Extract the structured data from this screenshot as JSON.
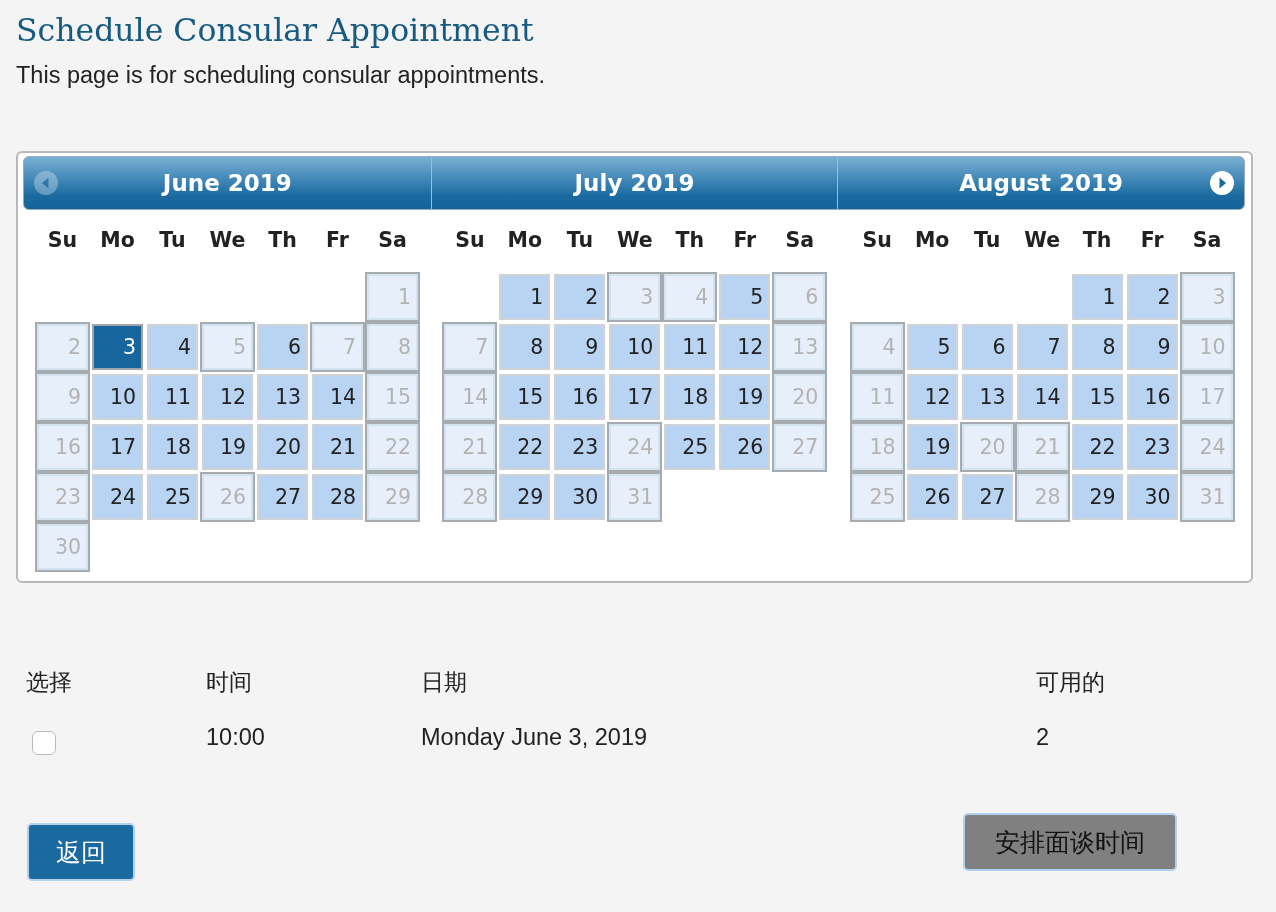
{
  "page": {
    "title": "Schedule Consular Appointment",
    "description": "This page is for scheduling consular appointments."
  },
  "calendar": {
    "previous_enabled": false,
    "next_enabled": true,
    "months": [
      {
        "title": "June 2019",
        "weekdays": [
          "Su",
          "Mo",
          "Tu",
          "We",
          "Th",
          "Fr",
          "Sa"
        ],
        "weeks": [
          [
            {
              "day": "1",
              "available": false,
              "selected": false
            }
          ],
          [
            {
              "day": "2",
              "available": false,
              "selected": false
            },
            {
              "day": "3",
              "available": true,
              "selected": true
            },
            {
              "day": "4",
              "available": true,
              "selected": false
            },
            {
              "day": "5",
              "available": false,
              "selected": false
            },
            {
              "day": "6",
              "available": true,
              "selected": false
            },
            {
              "day": "7",
              "available": false,
              "selected": false
            },
            {
              "day": "8",
              "available": false,
              "selected": false
            }
          ],
          [
            {
              "day": "9",
              "available": false,
              "selected": false
            },
            {
              "day": "10",
              "available": true,
              "selected": false
            },
            {
              "day": "11",
              "available": true,
              "selected": false
            },
            {
              "day": "12",
              "available": true,
              "selected": false
            },
            {
              "day": "13",
              "available": true,
              "selected": false
            },
            {
              "day": "14",
              "available": true,
              "selected": false
            },
            {
              "day": "15",
              "available": false,
              "selected": false
            }
          ],
          [
            {
              "day": "16",
              "available": false,
              "selected": false
            },
            {
              "day": "17",
              "available": true,
              "selected": false
            },
            {
              "day": "18",
              "available": true,
              "selected": false
            },
            {
              "day": "19",
              "available": true,
              "selected": false
            },
            {
              "day": "20",
              "available": true,
              "selected": false
            },
            {
              "day": "21",
              "available": true,
              "selected": false
            },
            {
              "day": "22",
              "available": false,
              "selected": false
            }
          ],
          [
            {
              "day": "23",
              "available": false,
              "selected": false
            },
            {
              "day": "24",
              "available": true,
              "selected": false
            },
            {
              "day": "25",
              "available": true,
              "selected": false
            },
            {
              "day": "26",
              "available": false,
              "selected": false
            },
            {
              "day": "27",
              "available": true,
              "selected": false
            },
            {
              "day": "28",
              "available": true,
              "selected": false
            },
            {
              "day": "29",
              "available": false,
              "selected": false
            }
          ],
          [
            {
              "day": "30",
              "available": false,
              "selected": false
            }
          ]
        ]
      },
      {
        "title": "July 2019",
        "weekdays": [
          "Su",
          "Mo",
          "Tu",
          "We",
          "Th",
          "Fr",
          "Sa"
        ],
        "weeks": [
          [
            {
              "day": "1",
              "available": true,
              "selected": false
            },
            {
              "day": "2",
              "available": true,
              "selected": false
            },
            {
              "day": "3",
              "available": false,
              "selected": false
            },
            {
              "day": "4",
              "available": false,
              "selected": false
            },
            {
              "day": "5",
              "available": true,
              "selected": false
            },
            {
              "day": "6",
              "available": false,
              "selected": false
            }
          ],
          [
            {
              "day": "7",
              "available": false,
              "selected": false
            },
            {
              "day": "8",
              "available": true,
              "selected": false
            },
            {
              "day": "9",
              "available": true,
              "selected": false
            },
            {
              "day": "10",
              "available": true,
              "selected": false
            },
            {
              "day": "11",
              "available": true,
              "selected": false
            },
            {
              "day": "12",
              "available": true,
              "selected": false
            },
            {
              "day": "13",
              "available": false,
              "selected": false
            }
          ],
          [
            {
              "day": "14",
              "available": false,
              "selected": false
            },
            {
              "day": "15",
              "available": true,
              "selected": false
            },
            {
              "day": "16",
              "available": true,
              "selected": false
            },
            {
              "day": "17",
              "available": true,
              "selected": false
            },
            {
              "day": "18",
              "available": true,
              "selected": false
            },
            {
              "day": "19",
              "available": true,
              "selected": false
            },
            {
              "day": "20",
              "available": false,
              "selected": false
            }
          ],
          [
            {
              "day": "21",
              "available": false,
              "selected": false
            },
            {
              "day": "22",
              "available": true,
              "selected": false
            },
            {
              "day": "23",
              "available": true,
              "selected": false
            },
            {
              "day": "24",
              "available": false,
              "selected": false
            },
            {
              "day": "25",
              "available": true,
              "selected": false
            },
            {
              "day": "26",
              "available": true,
              "selected": false
            },
            {
              "day": "27",
              "available": false,
              "selected": false
            }
          ],
          [
            {
              "day": "28",
              "available": false,
              "selected": false
            },
            {
              "day": "29",
              "available": true,
              "selected": false
            },
            {
              "day": "30",
              "available": true,
              "selected": false
            },
            {
              "day": "31",
              "available": false,
              "selected": false
            }
          ]
        ]
      },
      {
        "title": "August 2019",
        "weekdays": [
          "Su",
          "Mo",
          "Tu",
          "We",
          "Th",
          "Fr",
          "Sa"
        ],
        "weeks": [
          [
            {
              "day": "1",
              "available": true,
              "selected": false
            },
            {
              "day": "2",
              "available": true,
              "selected": false
            },
            {
              "day": "3",
              "available": false,
              "selected": false
            }
          ],
          [
            {
              "day": "4",
              "available": false,
              "selected": false
            },
            {
              "day": "5",
              "available": true,
              "selected": false
            },
            {
              "day": "6",
              "available": true,
              "selected": false
            },
            {
              "day": "7",
              "available": true,
              "selected": false
            },
            {
              "day": "8",
              "available": true,
              "selected": false
            },
            {
              "day": "9",
              "available": true,
              "selected": false
            },
            {
              "day": "10",
              "available": false,
              "selected": false
            }
          ],
          [
            {
              "day": "11",
              "available": false,
              "selected": false
            },
            {
              "day": "12",
              "available": true,
              "selected": false
            },
            {
              "day": "13",
              "available": true,
              "selected": false
            },
            {
              "day": "14",
              "available": true,
              "selected": false
            },
            {
              "day": "15",
              "available": true,
              "selected": false
            },
            {
              "day": "16",
              "available": true,
              "selected": false
            },
            {
              "day": "17",
              "available": false,
              "selected": false
            }
          ],
          [
            {
              "day": "18",
              "available": false,
              "selected": false
            },
            {
              "day": "19",
              "available": true,
              "selected": false
            },
            {
              "day": "20",
              "available": false,
              "selected": false
            },
            {
              "day": "21",
              "available": false,
              "selected": false
            },
            {
              "day": "22",
              "available": true,
              "selected": false
            },
            {
              "day": "23",
              "available": true,
              "selected": false
            },
            {
              "day": "24",
              "available": false,
              "selected": false
            }
          ],
          [
            {
              "day": "25",
              "available": false,
              "selected": false
            },
            {
              "day": "26",
              "available": true,
              "selected": false
            },
            {
              "day": "27",
              "available": true,
              "selected": false
            },
            {
              "day": "28",
              "available": false,
              "selected": false
            },
            {
              "day": "29",
              "available": true,
              "selected": false
            },
            {
              "day": "30",
              "available": true,
              "selected": false
            },
            {
              "day": "31",
              "available": false,
              "selected": false
            }
          ]
        ]
      }
    ]
  },
  "slots": {
    "columns": [
      "选择",
      "时间",
      "日期",
      "可用的"
    ],
    "rows": [
      {
        "checked": false,
        "time": "10:00",
        "date": "Monday June 3, 2019",
        "available": "2"
      }
    ]
  },
  "buttons": [
    {
      "label": "返回",
      "kind": "back"
    },
    {
      "label": "安排面谈时间",
      "kind": "schedule"
    }
  ]
}
